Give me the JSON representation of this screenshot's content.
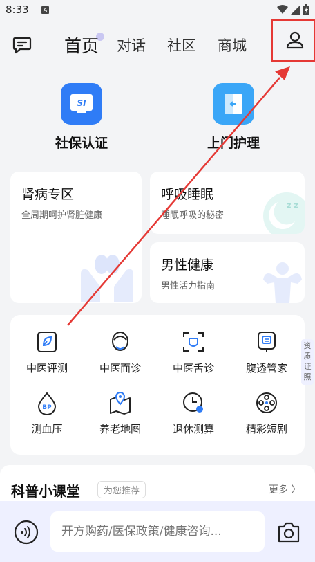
{
  "status": {
    "time": "8:33",
    "a_label": "A"
  },
  "nav": {
    "tabs": [
      "首页",
      "对话",
      "社区",
      "商城"
    ],
    "active_index": 0
  },
  "quick_actions": [
    {
      "label": "社保认证",
      "icon": "si-icon",
      "color": "#2f7cf6"
    },
    {
      "label": "上门护理",
      "icon": "door-icon",
      "color": "#3aa6f7"
    }
  ],
  "cards": [
    {
      "title": "肾病专区",
      "subtitle": "全周期呵护肾脏健康"
    },
    {
      "title": "呼吸睡眠",
      "subtitle": "睡眠呼吸的秘密"
    },
    {
      "title": "男性健康",
      "subtitle": "男性活力指南"
    }
  ],
  "services": [
    {
      "label": "中医评测",
      "icon": "tcm-eval-icon"
    },
    {
      "label": "中医面诊",
      "icon": "face-diagnosis-icon"
    },
    {
      "label": "中医舌诊",
      "icon": "tongue-diagnosis-icon"
    },
    {
      "label": "腹透管家",
      "icon": "dialysis-icon"
    },
    {
      "label": "测血压",
      "icon": "blood-pressure-icon"
    },
    {
      "label": "养老地图",
      "icon": "map-icon"
    },
    {
      "label": "退休测算",
      "icon": "clock-icon"
    },
    {
      "label": "精彩短剧",
      "icon": "film-icon"
    }
  ],
  "side_tag": "资质证照",
  "section": {
    "title": "科普小课堂",
    "tag": "为您推荐",
    "more": "更多 〉"
  },
  "bottom": {
    "placeholder": "开方购药/医保政策/健康咨询..."
  },
  "colors": {
    "accent": "#2f7cf6",
    "annotation": "#e53935"
  }
}
